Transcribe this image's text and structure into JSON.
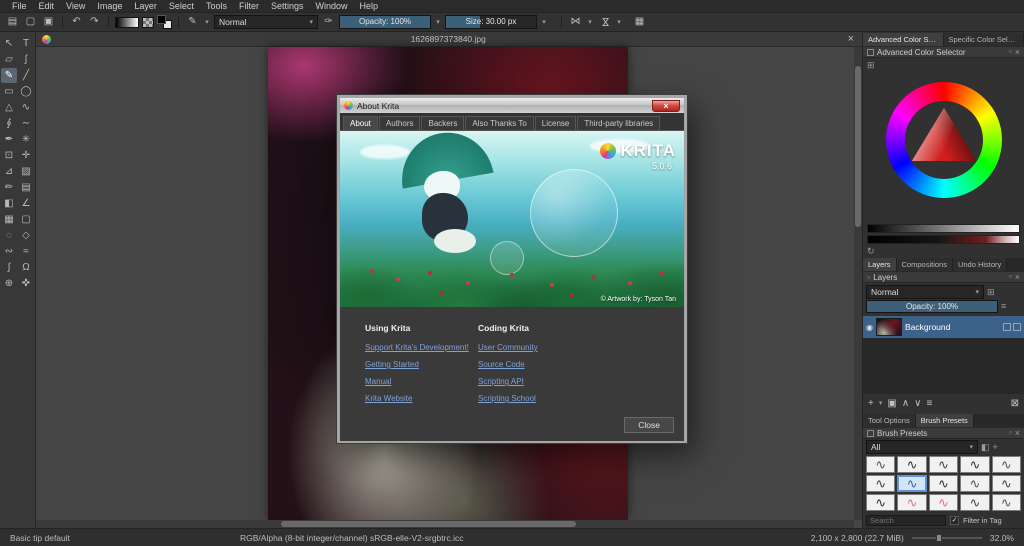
{
  "menu": {
    "items": [
      "File",
      "Edit",
      "View",
      "Image",
      "Layer",
      "Select",
      "Tools",
      "Filter",
      "Settings",
      "Window",
      "Help"
    ]
  },
  "toolbar": {
    "blend_mode": "Normal",
    "opacity_label": "Opacity: 100%",
    "opacity_pct": 100,
    "size_label": "Size: 30.00 px",
    "size_pct": 38
  },
  "icons": {
    "new_doc": "▤",
    "open_doc": "▢",
    "save_doc": "▣",
    "undo": "↶",
    "redo": "↷",
    "brush_editor": "✎",
    "choose_preset": "✑",
    "dropdown": "▾",
    "mirror": "⋈",
    "wrap": "▦",
    "close": "×",
    "float": "▫",
    "settings_grid": "⊞",
    "refresh": "↻",
    "pin": "◦",
    "eye": "◉",
    "add": "+",
    "duplicate": "▣",
    "up": "∧",
    "down": "∨",
    "properties": "≡",
    "delete": "⊠",
    "tag": "◧",
    "check": "✓"
  },
  "toolbox": {
    "tools": [
      {
        "name": "select-shapes",
        "glyph": "↖"
      },
      {
        "name": "text",
        "glyph": "T"
      },
      {
        "name": "edit-shapes",
        "glyph": "▱"
      },
      {
        "name": "calligraphy",
        "glyph": "ʃ"
      },
      {
        "name": "freehand-brush",
        "glyph": "✎",
        "selected": true
      },
      {
        "name": "line",
        "glyph": "╱"
      },
      {
        "name": "rectangle",
        "glyph": "▭"
      },
      {
        "name": "ellipse",
        "glyph": "◯"
      },
      {
        "name": "polygon",
        "glyph": "△"
      },
      {
        "name": "polyline",
        "glyph": "∿"
      },
      {
        "name": "bezier-curve",
        "glyph": "∮"
      },
      {
        "name": "freehand-path",
        "glyph": "∼"
      },
      {
        "name": "dynamic-brush",
        "glyph": "✒"
      },
      {
        "name": "multibrush",
        "glyph": "✳"
      },
      {
        "name": "transform",
        "glyph": "⊡"
      },
      {
        "name": "move",
        "glyph": "✛"
      },
      {
        "name": "crop",
        "glyph": "⊿"
      },
      {
        "name": "gradient",
        "glyph": "▨"
      },
      {
        "name": "color-sampler",
        "glyph": "✏"
      },
      {
        "name": "smart-patch",
        "glyph": "▤"
      },
      {
        "name": "fill",
        "glyph": "◧"
      },
      {
        "name": "assistants",
        "glyph": "∠"
      },
      {
        "name": "reference-images",
        "glyph": "▦"
      },
      {
        "name": "rectangular-selection",
        "glyph": "▢"
      },
      {
        "name": "elliptical-selection",
        "glyph": "◌"
      },
      {
        "name": "polygonal-selection",
        "glyph": "◇"
      },
      {
        "name": "freehand-selection",
        "glyph": "∾"
      },
      {
        "name": "similar-color-selection",
        "glyph": "≈"
      },
      {
        "name": "bezier-selection",
        "glyph": "∫"
      },
      {
        "name": "magnetic-selection",
        "glyph": "Ω"
      },
      {
        "name": "zoom",
        "glyph": "⊕"
      },
      {
        "name": "pan",
        "glyph": "✜"
      }
    ]
  },
  "canvas": {
    "tab_title": "1626897373840.jpg"
  },
  "dialog": {
    "title": "About Krita",
    "tabs": [
      {
        "label": "About",
        "selected": true
      },
      {
        "label": "Authors"
      },
      {
        "label": "Backers"
      },
      {
        "label": "Also Thanks To"
      },
      {
        "label": "License"
      },
      {
        "label": "Third-party libraries"
      }
    ],
    "brand": "KRITA",
    "version": "5.0.6",
    "credit": "© Artwork by: Tyson Tan",
    "using": {
      "heading": "Using Krita",
      "links": [
        "Support Krita's Development!",
        "Getting Started",
        "Manual",
        "Krita Website"
      ]
    },
    "coding": {
      "heading": "Coding Krita",
      "links": [
        "User Community",
        "Source Code",
        "Scripting API",
        "Scripting School"
      ]
    },
    "close_label": "Close"
  },
  "color_docker": {
    "tabs": [
      {
        "label": "Advanced Color Selec...",
        "selected": true
      },
      {
        "label": "Specific Color Selec..."
      }
    ],
    "title": "Advanced Color Selector"
  },
  "layers_docker": {
    "tabs": [
      {
        "label": "Layers",
        "selected": true
      },
      {
        "label": "Compositions"
      },
      {
        "label": "Undo History"
      }
    ],
    "title": "Layers",
    "blend_mode": "Normal",
    "opacity_label": "Opacity:  100%",
    "opacity_pct": 100,
    "layer_name": "Background"
  },
  "presets_docker": {
    "tabs": [
      {
        "label": "Tool Options"
      },
      {
        "label": "Brush Presets",
        "selected": true
      }
    ],
    "title": "Brush Presets",
    "tag_filter": "All",
    "search_placeholder": "Search",
    "filter_in_tag_label": "Filter in Tag",
    "presets": [
      {
        "glyph": "∿",
        "ink": "#555"
      },
      {
        "glyph": "∿",
        "ink": "#333"
      },
      {
        "glyph": "∿",
        "ink": "#444"
      },
      {
        "glyph": "∿",
        "ink": "#333"
      },
      {
        "glyph": "∿",
        "ink": "#555"
      },
      {
        "glyph": "∿",
        "ink": "#444"
      },
      {
        "glyph": "∿",
        "ink": "#2e6da0",
        "selected": true
      },
      {
        "glyph": "∿",
        "ink": "#333"
      },
      {
        "glyph": "∿",
        "ink": "#555"
      },
      {
        "glyph": "∿",
        "ink": "#444"
      },
      {
        "glyph": "∿",
        "ink": "#333"
      },
      {
        "glyph": "∿",
        "ink": "#e06fa0"
      },
      {
        "glyph": "∿",
        "ink": "#e06fa0"
      },
      {
        "glyph": "∿",
        "ink": "#444"
      },
      {
        "glyph": "∿",
        "ink": "#555"
      }
    ]
  },
  "status": {
    "tool_hint": "Basic tip default",
    "color_info": "RGB/Alpha (8-bit integer/channel)  sRGB-elle-V2-srgbtrc.icc",
    "dimensions": "2,100 x 2,800 (22.7 MiB)",
    "zoom": "32.0%",
    "zoom_slider_pct": 35
  }
}
